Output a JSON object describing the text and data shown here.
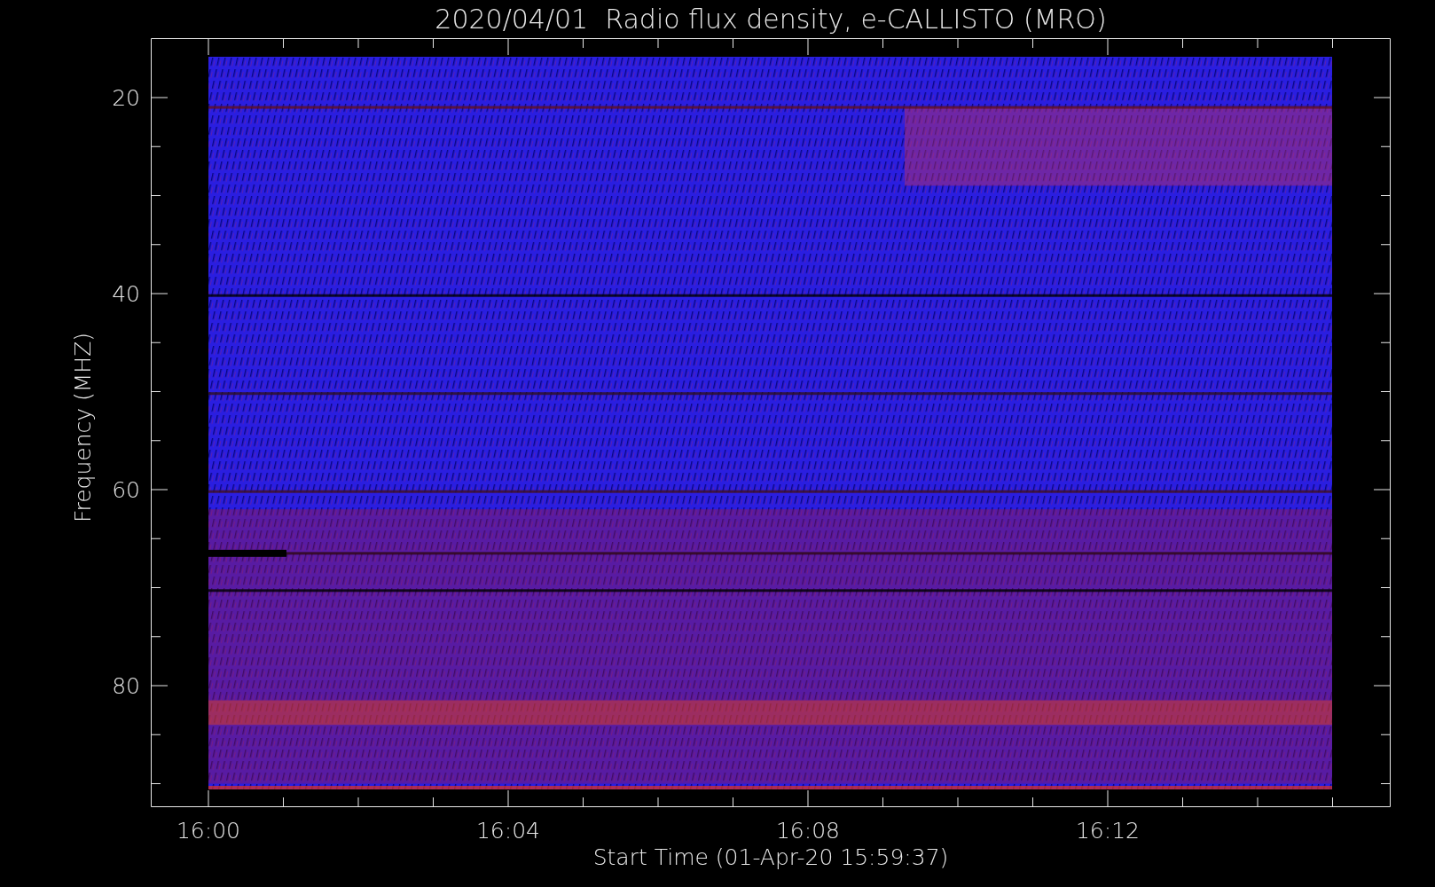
{
  "title": "2020/04/01  Radio flux density, e-CALLISTO (MRO)",
  "y_axis": {
    "label": "Frequency (MHZ)",
    "ticks": [
      "20",
      "40",
      "60",
      "80"
    ]
  },
  "x_axis": {
    "label": "Start Time (01-Apr-20 15:59:37)",
    "ticks": [
      "16:00",
      "16:04",
      "16:08",
      "16:12"
    ]
  }
}
